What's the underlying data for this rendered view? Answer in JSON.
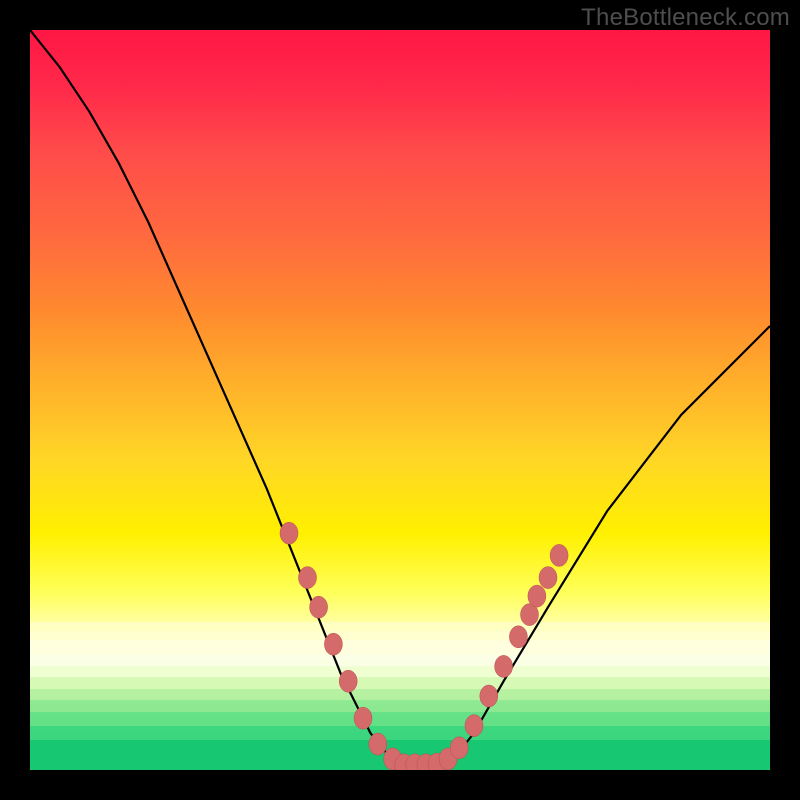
{
  "watermark": "TheBottleneck.com",
  "colors": {
    "frame_bg": "#000000",
    "watermark_text": "#4e4e4e",
    "curve": "#000000",
    "marker_fill": "#d46a6a",
    "marker_stroke": "#b94f4f"
  },
  "chart_data": {
    "type": "line",
    "title": "",
    "xlabel": "",
    "ylabel": "",
    "xlim": [
      0,
      100
    ],
    "ylim": [
      0,
      100
    ],
    "grid": false,
    "legend": false,
    "series": [
      {
        "name": "bottleneck-curve",
        "x": [
          0,
          4,
          8,
          12,
          16,
          20,
          24,
          28,
          32,
          34,
          36,
          38,
          40,
          42,
          44,
          46,
          48,
          50,
          52,
          54,
          56,
          58,
          60,
          64,
          70,
          78,
          88,
          100
        ],
        "y": [
          100,
          95,
          89,
          82,
          74,
          65,
          56,
          47,
          38,
          33,
          28,
          23,
          18,
          13,
          9,
          5,
          2.5,
          1,
          0.5,
          0.5,
          1,
          2.5,
          5,
          12,
          22,
          35,
          48,
          60
        ]
      }
    ],
    "markers": {
      "name": "hotspots",
      "points": [
        {
          "x": 35,
          "y": 32
        },
        {
          "x": 37.5,
          "y": 26
        },
        {
          "x": 39,
          "y": 22
        },
        {
          "x": 41,
          "y": 17
        },
        {
          "x": 43,
          "y": 12
        },
        {
          "x": 45,
          "y": 7
        },
        {
          "x": 47,
          "y": 3.5
        },
        {
          "x": 49,
          "y": 1.5
        },
        {
          "x": 50.5,
          "y": 0.7
        },
        {
          "x": 52,
          "y": 0.7
        },
        {
          "x": 53.5,
          "y": 0.7
        },
        {
          "x": 55,
          "y": 0.8
        },
        {
          "x": 56.5,
          "y": 1.5
        },
        {
          "x": 58,
          "y": 3
        },
        {
          "x": 60,
          "y": 6
        },
        {
          "x": 62,
          "y": 10
        },
        {
          "x": 64,
          "y": 14
        },
        {
          "x": 66,
          "y": 18
        },
        {
          "x": 67.5,
          "y": 21
        },
        {
          "x": 68.5,
          "y": 23.5
        },
        {
          "x": 70,
          "y": 26
        },
        {
          "x": 71.5,
          "y": 29
        }
      ]
    },
    "gradient_stops": [
      {
        "pct": 0,
        "color": "#ff1744"
      },
      {
        "pct": 50,
        "color": "#ffd626"
      },
      {
        "pct": 84,
        "color": "#ffffe0"
      },
      {
        "pct": 100,
        "color": "#11c56f"
      }
    ]
  }
}
